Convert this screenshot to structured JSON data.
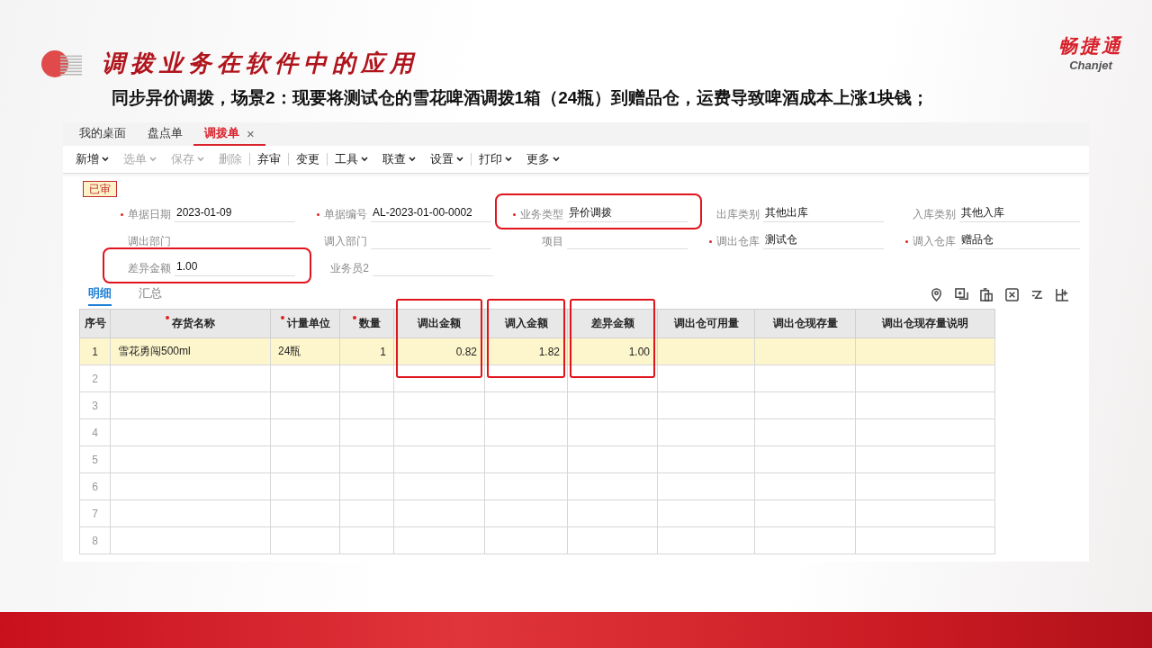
{
  "slide": {
    "title": "调拨业务在软件中的应用",
    "subtitle": "同步异价调拨，场景2：现要将测试仓的雪花啤酒调拨1箱（24瓶）到赠品仓，运费导致啤酒成本上涨1块钱；"
  },
  "brand": {
    "name_cn": "畅捷通",
    "name_en": "Chanjet"
  },
  "tabs": [
    {
      "label": "我的桌面",
      "selected": false
    },
    {
      "label": "盘点单",
      "selected": false
    },
    {
      "label": "调拨单",
      "selected": true,
      "close": "×"
    }
  ],
  "toolbar": [
    {
      "label": "新增",
      "dropdown": true,
      "disabled": false,
      "divider_before": false
    },
    {
      "label": "选单",
      "dropdown": true,
      "disabled": true,
      "divider_before": false
    },
    {
      "label": "保存",
      "dropdown": true,
      "disabled": true,
      "divider_before": false
    },
    {
      "label": "删除",
      "dropdown": false,
      "disabled": true,
      "divider_before": false
    },
    {
      "label": "弃审",
      "dropdown": false,
      "disabled": false,
      "divider_before": true
    },
    {
      "label": "变更",
      "dropdown": false,
      "disabled": false,
      "divider_before": true
    },
    {
      "label": "工具",
      "dropdown": true,
      "disabled": false,
      "divider_before": true
    },
    {
      "label": "联查",
      "dropdown": true,
      "disabled": false,
      "divider_before": false
    },
    {
      "label": "设置",
      "dropdown": true,
      "disabled": false,
      "divider_before": false
    },
    {
      "label": "打印",
      "dropdown": true,
      "disabled": false,
      "divider_before": true
    },
    {
      "label": "更多",
      "dropdown": true,
      "disabled": false,
      "divider_before": false
    }
  ],
  "status_badge": "已审",
  "form_rows": [
    [
      {
        "label": "单据日期",
        "value": "2023-01-09",
        "required": true,
        "highlighted": false
      },
      {
        "label": "单据编号",
        "value": "AL-2023-01-00-0002",
        "required": true,
        "highlighted": false
      },
      {
        "label": "业务类型",
        "value": "异价调拨",
        "required": true,
        "highlighted": true
      },
      {
        "label": "出库类别",
        "value": "其他出库",
        "required": false,
        "highlighted": false
      },
      {
        "label": "入库类别",
        "value": "其他入库",
        "required": false,
        "highlighted": false
      }
    ],
    [
      {
        "label": "调出部门",
        "required": false,
        "highlighted": false
      },
      {
        "label": "调入部门",
        "required": false,
        "highlighted": false
      },
      {
        "label": "项目",
        "required": false,
        "highlighted": false
      },
      {
        "label": "调出仓库",
        "value": "测试仓",
        "required": true,
        "highlighted": false
      },
      {
        "label": "调入仓库",
        "value": "赠品仓",
        "required": true,
        "highlighted": false
      }
    ],
    [
      {
        "label": "差异金额",
        "value": "1.00",
        "required": false,
        "highlighted": true
      },
      {
        "label": "业务员2",
        "required": false,
        "highlighted": false
      }
    ]
  ],
  "sub_tabs": [
    {
      "label": "明细",
      "selected": true
    },
    {
      "label": "汇总",
      "selected": false
    }
  ],
  "table": {
    "columns": [
      {
        "label": "序号",
        "required": false,
        "highlighted": false
      },
      {
        "label": "存货名称",
        "required": true,
        "highlighted": false
      },
      {
        "label": "计量单位",
        "required": true,
        "highlighted": false
      },
      {
        "label": "数量",
        "required": true,
        "highlighted": false
      },
      {
        "label": "调出金额",
        "required": false,
        "highlighted": true
      },
      {
        "label": "调入金额",
        "required": false,
        "highlighted": true
      },
      {
        "label": "差异金额",
        "required": false,
        "highlighted": true
      },
      {
        "label": "调出仓可用量",
        "required": false,
        "highlighted": false
      },
      {
        "label": "调出仓现存量",
        "required": false,
        "highlighted": false
      },
      {
        "label": "调出仓现存量说明",
        "required": false,
        "highlighted": false
      }
    ],
    "rows": [
      {
        "index": "1",
        "selected": true,
        "cells": [
          "雪花勇闯500ml",
          "24瓶",
          "1",
          "0.82",
          "1.82",
          "1.00"
        ]
      },
      {
        "index": "2",
        "selected": false
      },
      {
        "index": "3",
        "selected": false
      },
      {
        "index": "4",
        "selected": false
      },
      {
        "index": "5",
        "selected": false
      },
      {
        "index": "6",
        "selected": false
      },
      {
        "index": "7",
        "selected": false
      },
      {
        "index": "8",
        "selected": false
      }
    ]
  }
}
